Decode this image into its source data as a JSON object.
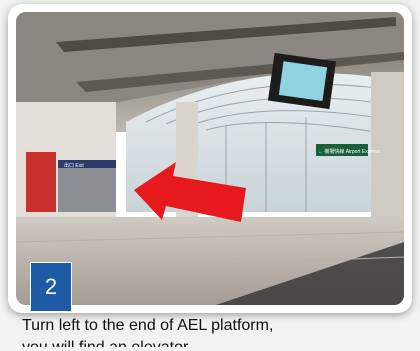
{
  "step": {
    "number": "2"
  },
  "caption": {
    "line1": "Turn left to the end of AEL platform,",
    "line2": "you will find an elevator."
  },
  "signs": {
    "gate_small": "出口 Exit",
    "platform_sign": "← 機場快線 Airport Express"
  },
  "colors": {
    "badge": "#1f5aa6",
    "arrow": "#e8191d",
    "sign_green": "#1b5e3b"
  }
}
